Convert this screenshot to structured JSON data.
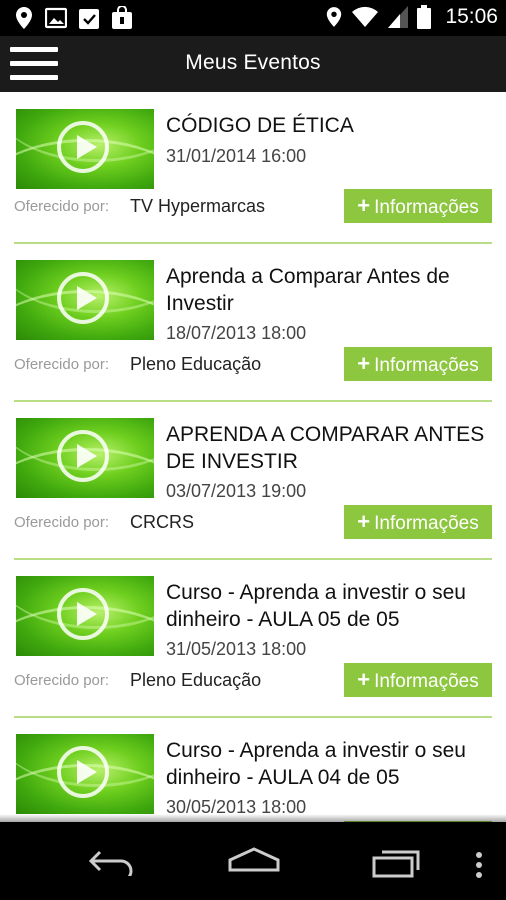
{
  "status_bar": {
    "time": "15:06",
    "left_icons": [
      "location-icon",
      "image-icon",
      "clipboard-check-icon",
      "shopping-bag-icon"
    ],
    "right_icons": [
      "location-icon",
      "wifi-icon",
      "signal-icon",
      "battery-icon"
    ]
  },
  "app_bar": {
    "title": "Meus Eventos"
  },
  "offered_by_label": "Oferecido por:",
  "info_button_label": "Informações",
  "info_button_plus": "+",
  "events": [
    {
      "title": "CÓDIGO DE ÉTICA",
      "date": "31/01/2014 16:00",
      "offered_by": "TV Hypermarcas"
    },
    {
      "title": "Aprenda a Comparar Antes de Investir",
      "date": "18/07/2013 18:00",
      "offered_by": "Pleno Educação"
    },
    {
      "title": "APRENDA A COMPARAR ANTES DE INVESTIR",
      "date": "03/07/2013 19:00",
      "offered_by": "CRCRS"
    },
    {
      "title": "Curso - Aprenda a investir o seu dinheiro - AULA 05 de 05",
      "date": "31/05/2013 18:00",
      "offered_by": "Pleno Educação"
    },
    {
      "title": "Curso - Aprenda a investir o seu dinheiro - AULA 04 de 05",
      "date": "30/05/2013 18:00",
      "offered_by": ""
    }
  ],
  "nav_bar": {
    "buttons": [
      "back-icon",
      "home-icon",
      "recent-apps-icon",
      "overflow-menu-icon"
    ]
  },
  "colors": {
    "accent_green": "#8dc63f",
    "divider_green": "#b9dc86",
    "app_bar": "#1b1b1b"
  }
}
